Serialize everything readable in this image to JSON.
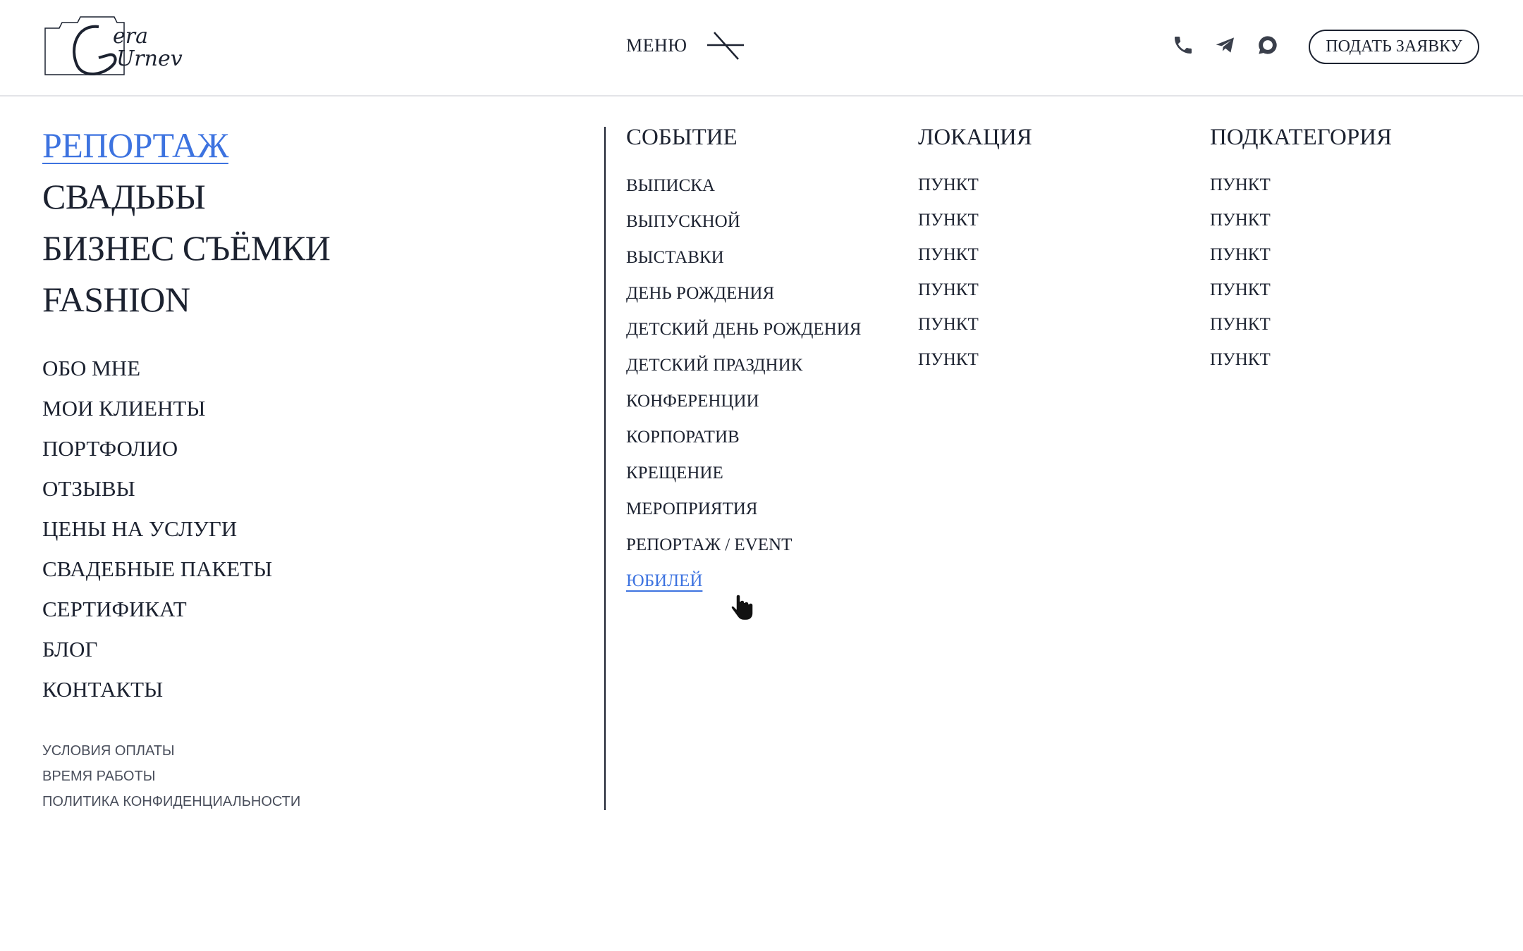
{
  "header": {
    "logo": {
      "line1": "era",
      "line2": "Urnev"
    },
    "menu_label": "МЕНЮ",
    "cta_label": "ПОДАТЬ ЗАЯВКУ",
    "icons": [
      "phone-icon",
      "telegram-icon",
      "chat-icon",
      "close-icon"
    ]
  },
  "main_categories": [
    {
      "label": "РЕПОРТАЖ",
      "active": true
    },
    {
      "label": "СВАДЬБЫ"
    },
    {
      "label": "БИЗНЕС СЪЁМКИ"
    },
    {
      "label": "FASHION"
    }
  ],
  "secondary_links": [
    "ОБО МНЕ",
    "МОИ КЛИЕНТЫ",
    "ПОРТФОЛИО",
    "ОТЗЫВЫ",
    "ЦЕНЫ НА УСЛУГИ",
    "СВАДЕБНЫЕ ПАКЕТЫ",
    "СЕРТИФИКАТ",
    "БЛОГ",
    "КОНТАКТЫ"
  ],
  "footer_links": [
    "УСЛОВИЯ ОПЛАТЫ",
    "ВРЕМЯ РАБОТЫ",
    "ПОЛИТИКА КОНФИДЕНЦИАЛЬНОСТИ"
  ],
  "events": {
    "title": "СОБЫТИЕ",
    "items": [
      "ВЫПИСКА",
      "ВЫПУСКНОЙ",
      "ВЫСТАВКИ",
      "ДЕНЬ РОЖДЕНИЯ",
      "ДЕТСКИЙ ДЕНЬ РОЖДЕНИЯ",
      "ДЕТСКИЙ ПРАЗДНИК",
      "КОНФЕРЕНЦИИ",
      "КОРПОРАТИВ",
      "КРЕЩЕНИЕ",
      "МЕРОПРИЯТИЯ",
      "РЕПОРТАЖ / EVENT",
      "ЮБИЛЕЙ"
    ],
    "active_item": "ЮБИЛЕЙ"
  },
  "locations": {
    "title": "ЛОКАЦИЯ",
    "items": [
      "ПУНКТ",
      "ПУНКТ",
      "ПУНКТ",
      "ПУНКТ",
      "ПУНКТ",
      "ПУНКТ"
    ]
  },
  "subcategories": {
    "title": "ПОДКАТЕГОРИЯ",
    "items": [
      "ПУНКТ",
      "ПУНКТ",
      "ПУНКТ",
      "ПУНКТ",
      "ПУНКТ",
      "ПУНКТ"
    ]
  },
  "colors": {
    "text": "#1c2230",
    "accent": "#3d73e0",
    "muted": "#4a4f5c",
    "divider": "#e3e4e8"
  }
}
